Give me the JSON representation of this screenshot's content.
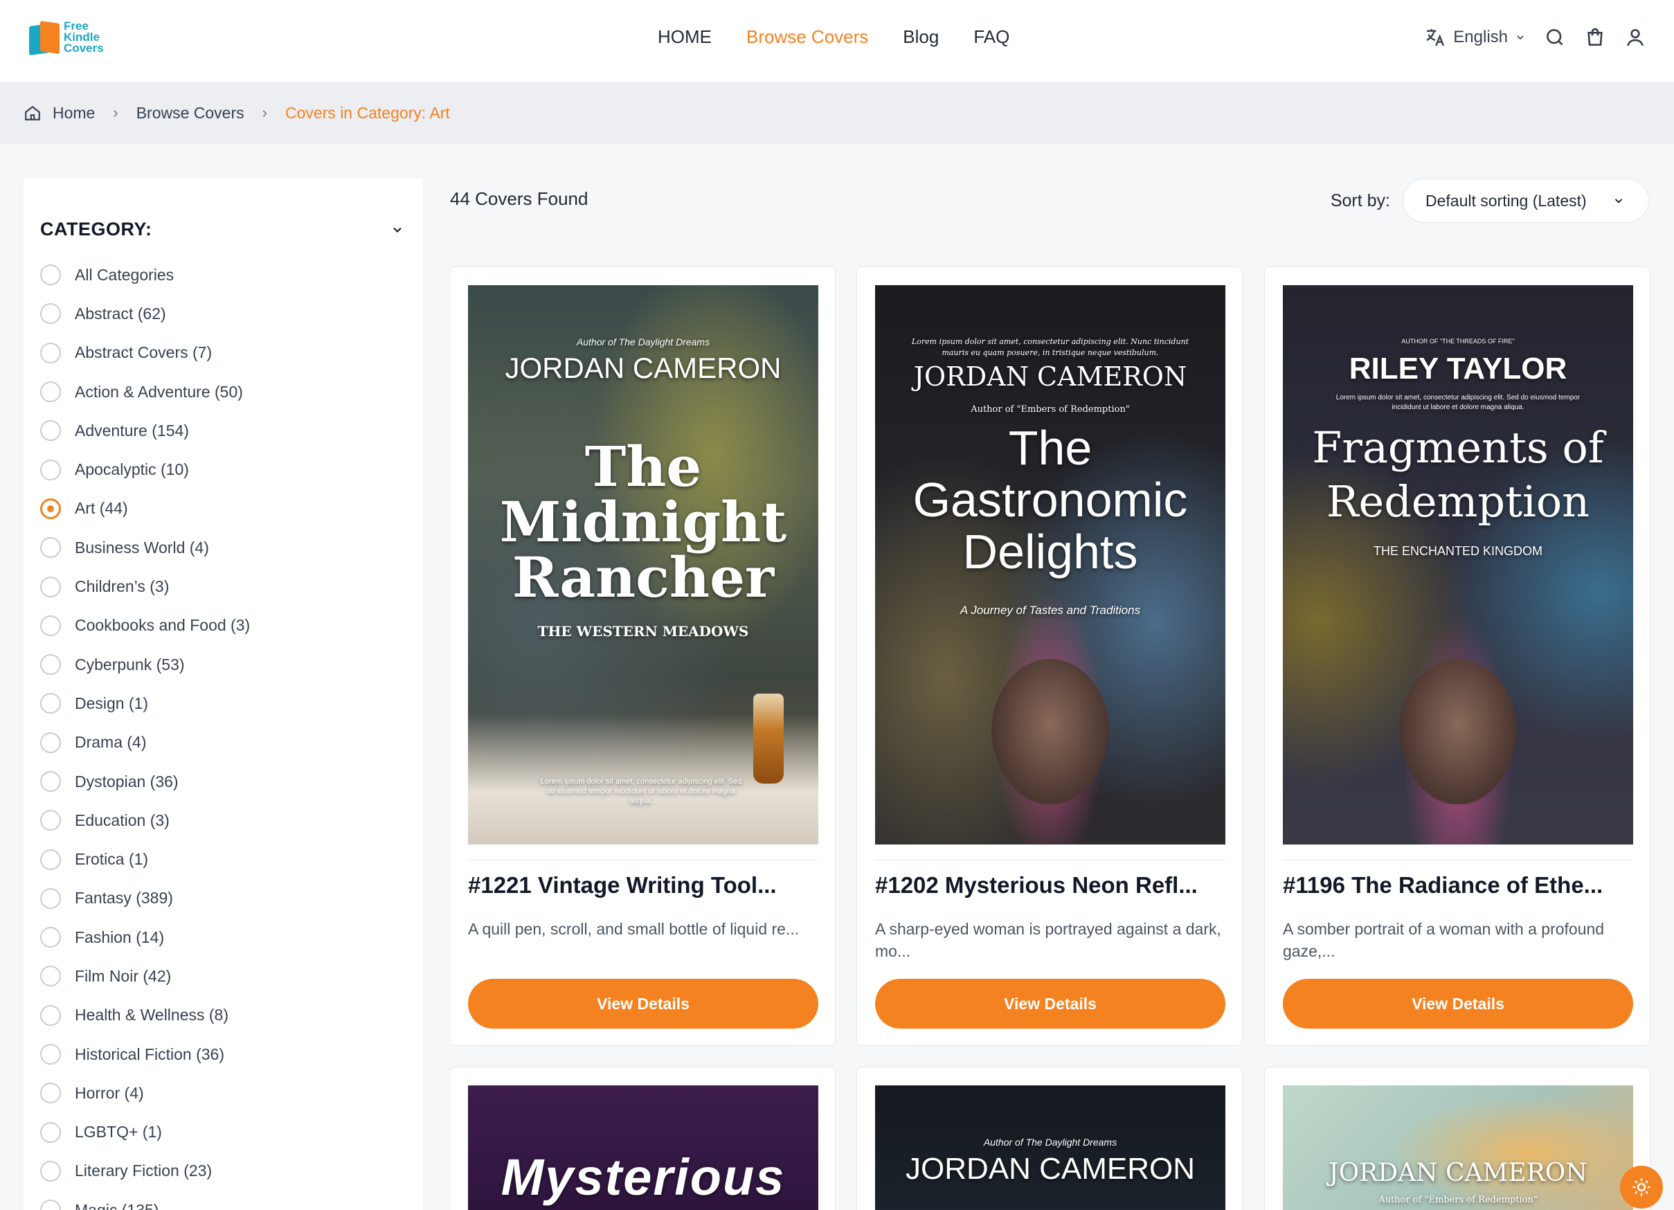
{
  "logo": {
    "line1": "Free",
    "line2": "Kindle",
    "line3": "Covers"
  },
  "nav": {
    "items": [
      "HOME",
      "Browse Covers",
      "Blog",
      "FAQ"
    ],
    "active": "Browse Covers"
  },
  "header": {
    "language": "English"
  },
  "breadcrumb": {
    "home": "Home",
    "browse": "Browse Covers",
    "current": "Covers in Category: Art"
  },
  "sidebar": {
    "heading": "CATEGORY:",
    "items": [
      "All Categories",
      "Abstract (62)",
      "Abstract Covers (7)",
      "Action & Adventure (50)",
      "Adventure (154)",
      "Apocalyptic (10)",
      "Art (44)",
      "Business World (4)",
      "Children’s (3)",
      "Cookbooks and Food (3)",
      "Cyberpunk (53)",
      "Design (1)",
      "Drama (4)",
      "Dystopian (36)",
      "Education (3)",
      "Erotica (1)",
      "Fantasy (389)",
      "Fashion (14)",
      "Film Noir (42)",
      "Health & Wellness (8)",
      "Historical Fiction (36)",
      "Horror (4)",
      "LGBTQ+ (1)",
      "Literary Fiction (23)",
      "Magic (135)"
    ],
    "selected": "Art (44)"
  },
  "results": {
    "count_label": "44 Covers Found",
    "sort_label": "Sort by:",
    "sort_value": "Default sorting (Latest)"
  },
  "cards": [
    {
      "title": "#1221 Vintage Writing Tool...",
      "desc": "A quill pen, scroll, and small bottle of liquid re...",
      "button": "View Details",
      "cover": {
        "tagline": "Author of The Daylight Dreams",
        "author": "JORDAN CAMERON",
        "book_title": "The Midnight Rancher",
        "subtitle": "THE WESTERN MEADOWS",
        "blurb": "Lorem ipsum dolor sit amet, consectetur adipiscing elit. Sed do eiusmod tempor incididunt ut labore et dolore magna aliqua."
      }
    },
    {
      "title": "#1202 Mysterious Neon Refl...",
      "desc": "A sharp-eyed woman is portrayed against a dark, mo...",
      "button": "View Details",
      "cover": {
        "blurb": "Lorem ipsum dolor sit amet, consectetur adipiscing elit. Nunc tincidunt mauris eu quam posuere, in tristique neque vestibulum.",
        "author": "JORDAN CAMERON",
        "tagline": "Author of \"Embers of Redemption\"",
        "book_title": "The Gastronomic Delights",
        "subtitle": "A Journey of Tastes and Traditions"
      }
    },
    {
      "title": "#1196 The Radiance of Ethe...",
      "desc": "A somber portrait of a woman with a profound gaze,...",
      "button": "View Details",
      "cover": {
        "tagline": "AUTHOR OF \"THE THREADS OF FIRE\"",
        "author": "RILEY TAYLOR",
        "blurb": "Lorem ipsum dolor sit amet, consectetur adipiscing elit. Sed do eiusmod tempor incididunt ut labore et dolore magna aliqua.",
        "book_title": "Fragments of Redemption",
        "subtitle": "THE ENCHANTED KINGDOM"
      }
    },
    {
      "cover": {
        "book_title": "Mysterious"
      }
    },
    {
      "cover": {
        "tagline": "Author of The Daylight Dreams",
        "author": "JORDAN CAMERON"
      }
    },
    {
      "cover": {
        "author": "JORDAN CAMERON",
        "tagline": "Author of \"Embers of Redemption\""
      }
    }
  ],
  "colors": {
    "accent": "#f58220",
    "brand_teal": "#1ca7c4"
  }
}
